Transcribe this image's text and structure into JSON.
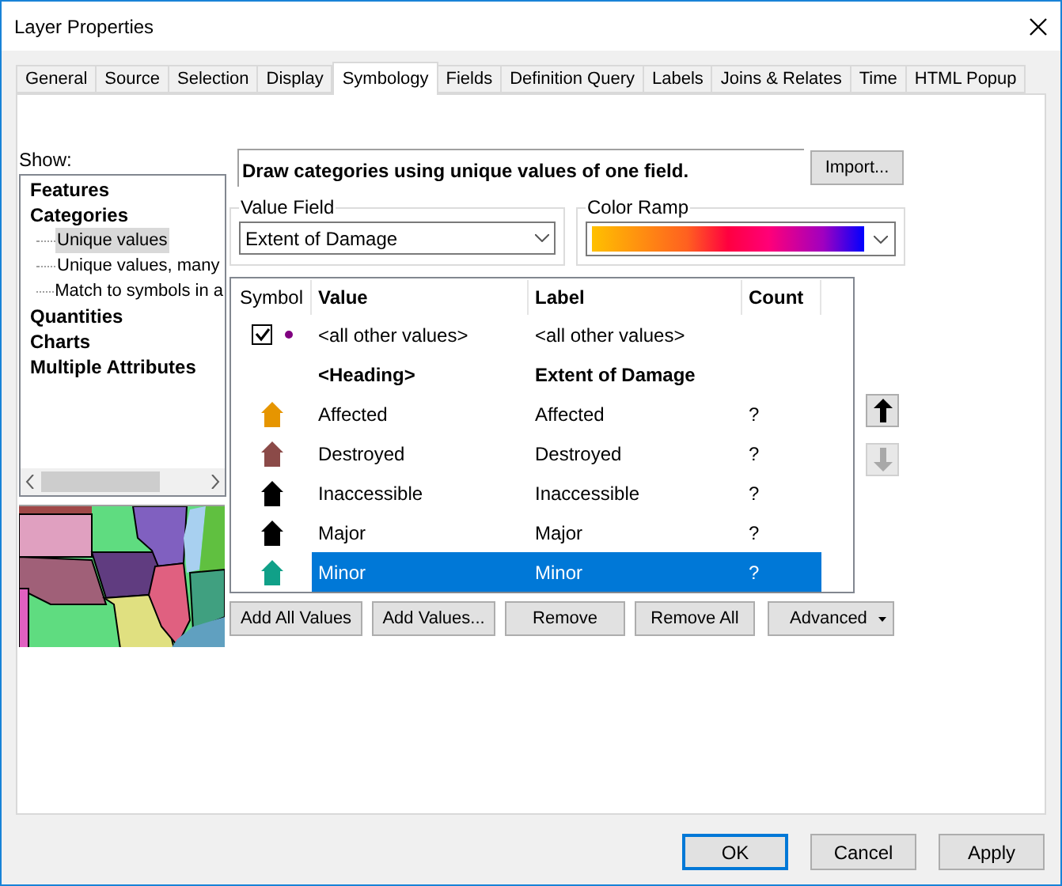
{
  "window": {
    "title": "Layer Properties"
  },
  "tabs": [
    {
      "label": "General",
      "selected": false
    },
    {
      "label": "Source",
      "selected": false
    },
    {
      "label": "Selection",
      "selected": false
    },
    {
      "label": "Display",
      "selected": false
    },
    {
      "label": "Symbology",
      "selected": true
    },
    {
      "label": "Fields",
      "selected": false
    },
    {
      "label": "Definition Query",
      "selected": false
    },
    {
      "label": "Labels",
      "selected": false
    },
    {
      "label": "Joins & Relates",
      "selected": false
    },
    {
      "label": "Time",
      "selected": false
    },
    {
      "label": "HTML Popup",
      "selected": false
    }
  ],
  "show": {
    "label": "Show:",
    "tree": [
      {
        "label": "Features",
        "selected": false
      },
      {
        "label": "Categories",
        "selected": false,
        "children": [
          {
            "label": "Unique values",
            "selected": true
          },
          {
            "label": "Unique values, many",
            "selected": false
          },
          {
            "label": "Match to symbols in a",
            "selected": false
          }
        ]
      },
      {
        "label": "Quantities",
        "selected": false
      },
      {
        "label": "Charts",
        "selected": false
      },
      {
        "label": "Multiple Attributes",
        "selected": false
      }
    ]
  },
  "description": "Draw categories using unique values of one field.",
  "import_button": "Import...",
  "value_field": {
    "label": "Value Field",
    "value": "Extent of Damage"
  },
  "color_ramp": {
    "label": "Color Ramp"
  },
  "table": {
    "columns": [
      "Symbol",
      "Value",
      "Label",
      "Count"
    ],
    "rows": [
      {
        "kind": "other",
        "checked": true,
        "color": "#800080",
        "value": "<all other values>",
        "label": "<all other values>",
        "selected": false
      },
      {
        "kind": "heading",
        "value": "<Heading>",
        "label": "Extent of Damage",
        "selected": false
      },
      {
        "kind": "value",
        "color": "#e69500",
        "value": "Affected",
        "label": "Affected",
        "count": "?",
        "selected": false
      },
      {
        "kind": "value",
        "color": "#8b4a48",
        "value": "Destroyed",
        "label": "Destroyed",
        "count": "?",
        "selected": false
      },
      {
        "kind": "value",
        "color": "#000000",
        "value": "Inaccessible",
        "label": "Inaccessible",
        "count": "?",
        "selected": false
      },
      {
        "kind": "value",
        "color": "#000000",
        "value": "Major",
        "label": "Major",
        "count": "?",
        "selected": false
      },
      {
        "kind": "value",
        "color": "#10a088",
        "value": "Minor",
        "label": "Minor",
        "count": "?",
        "selected": true
      }
    ]
  },
  "move_buttons": [
    {
      "kind": "up",
      "disabled": false
    },
    {
      "kind": "down",
      "disabled": true
    }
  ],
  "action_buttons": [
    "Add All Values",
    "Add Values...",
    "Remove",
    "Remove All"
  ],
  "advanced_button": "Advanced",
  "footer_buttons": [
    {
      "label": "OK",
      "default": true
    },
    {
      "label": "Cancel",
      "default": false
    },
    {
      "label": "Apply",
      "default": false
    }
  ]
}
